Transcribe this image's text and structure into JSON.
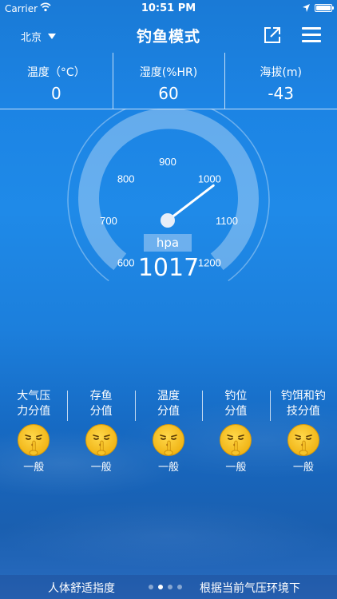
{
  "status_bar": {
    "carrier": "Carrier",
    "time": "10:51 PM"
  },
  "nav": {
    "city": "北京",
    "title": "钓鱼模式"
  },
  "stats": [
    {
      "label": "温度（°C）",
      "value": "0"
    },
    {
      "label": "湿度(%HR)",
      "value": "60"
    },
    {
      "label": "海拔(m)",
      "value": "-43"
    }
  ],
  "gauge": {
    "ticks": [
      "600",
      "700",
      "800",
      "900",
      "1000",
      "1100",
      "1200"
    ],
    "min": 600,
    "max": 1200,
    "unit": "hpa",
    "value": "1017"
  },
  "indexes": [
    {
      "name": "大气压\n力分值",
      "level": "一般"
    },
    {
      "name": "存鱼\n分值",
      "level": "一般"
    },
    {
      "name": "温度\n分值",
      "level": "一般"
    },
    {
      "name": "钓位\n分值",
      "level": "一般"
    },
    {
      "name": "钓饵和钓\n技分值",
      "level": "一般"
    }
  ],
  "bottom": {
    "left_label": "人体舒适指度",
    "right_label": "根据当前气压环境下",
    "page_count": 4,
    "active_page": 1
  },
  "colors": {
    "face": "#f6c21a",
    "face_shadow": "#e6a40e",
    "background_top": "#1a7ad6"
  }
}
